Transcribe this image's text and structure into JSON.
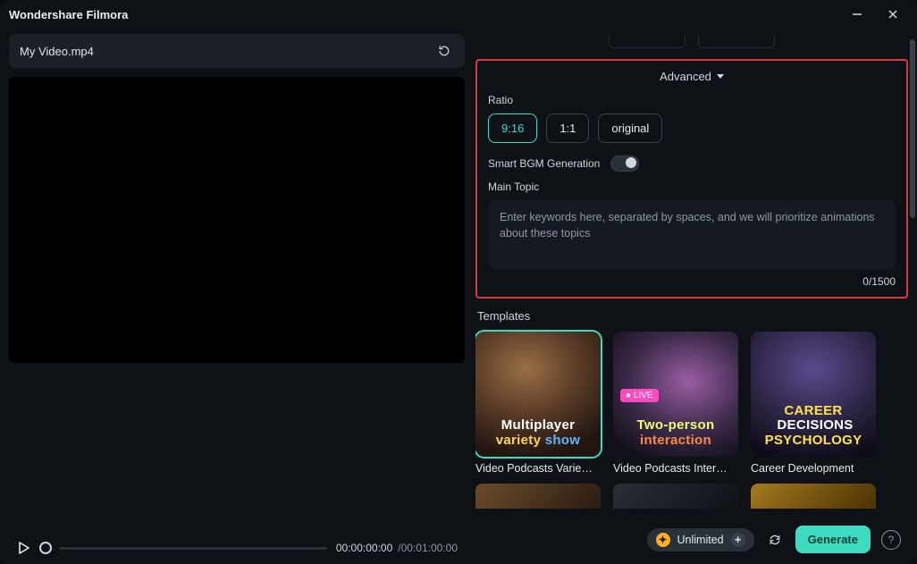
{
  "app": {
    "title": "Wondershare Filmora"
  },
  "file": {
    "name": "My Video.mp4"
  },
  "transport": {
    "current": "00:00:00:00",
    "duration": "/00:01:00:00"
  },
  "panel": {
    "advanced_label": "Advanced",
    "ratio_label": "Ratio",
    "ratios": {
      "r916": "9:16",
      "r11": "1:1",
      "roriginal": "original"
    },
    "bgm_label": "Smart BGM Generation",
    "main_topic_label": "Main Topic",
    "topic_placeholder": "Enter keywords here, separated by spaces, and we will prioritize animations about these topics",
    "counter": "0/1500"
  },
  "templates": {
    "heading": "Templates",
    "t1": {
      "caption": "Video Podcasts Varie…",
      "o_l1": "Multiplayer",
      "o_l2": "variety",
      "o_l3": "show"
    },
    "t2": {
      "caption": "Video Podcasts Inter…",
      "o_l1": "Two-person",
      "o_l2": "interaction",
      "live": "● LIVE"
    },
    "t3": {
      "caption": "Career Development",
      "o_l1": "CAREER",
      "o_l2": "DECISIONS",
      "o_l3": "PSYCHOLOGY"
    }
  },
  "footer": {
    "unlimited_label": "Unlimited",
    "generate_label": "Generate"
  }
}
